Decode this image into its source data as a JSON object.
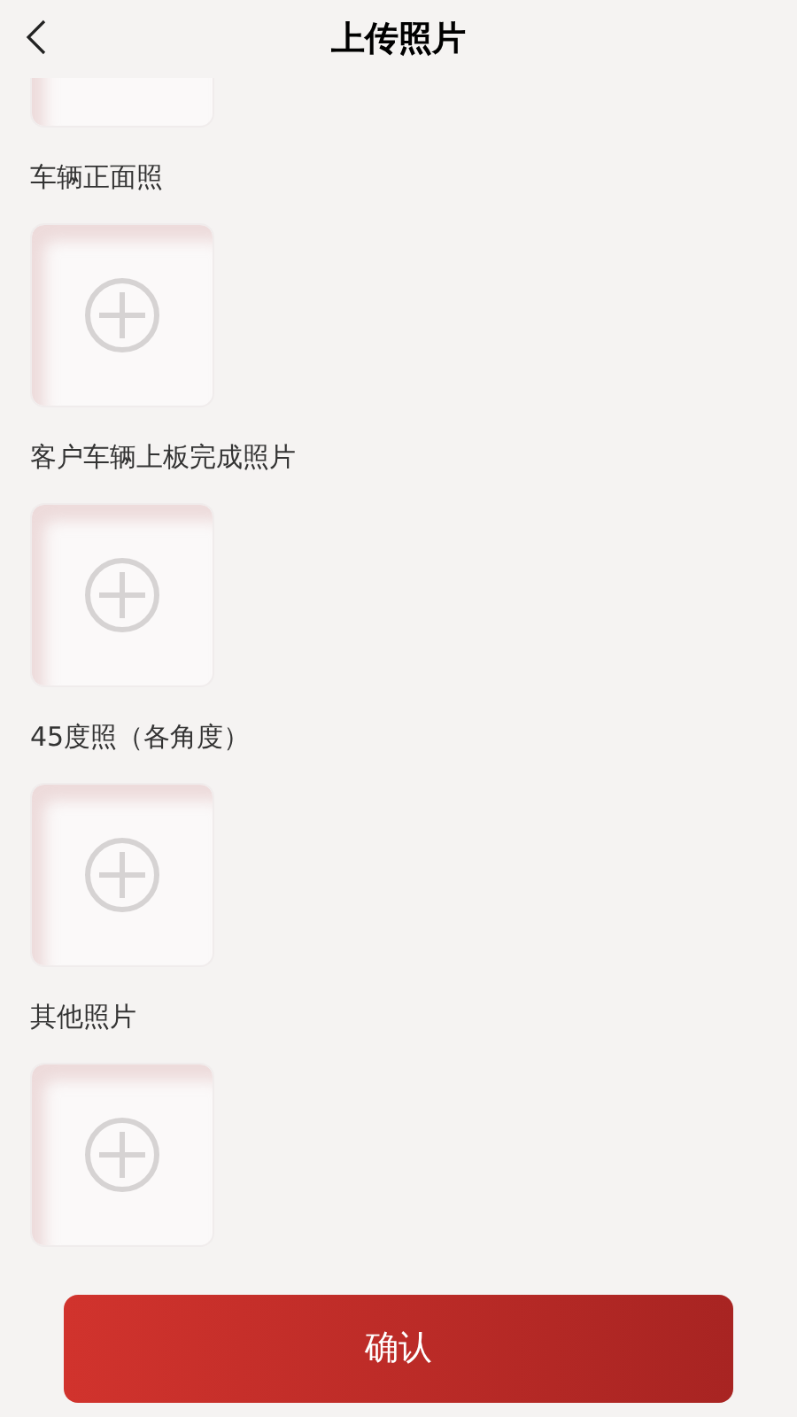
{
  "header": {
    "title": "上传照片"
  },
  "sections": [
    {
      "label": "车辆正面照"
    },
    {
      "label": "客户车辆上板完成照片"
    },
    {
      "label": "45度照（各角度）"
    },
    {
      "label": "其他照片"
    }
  ],
  "confirm_button": "确认"
}
